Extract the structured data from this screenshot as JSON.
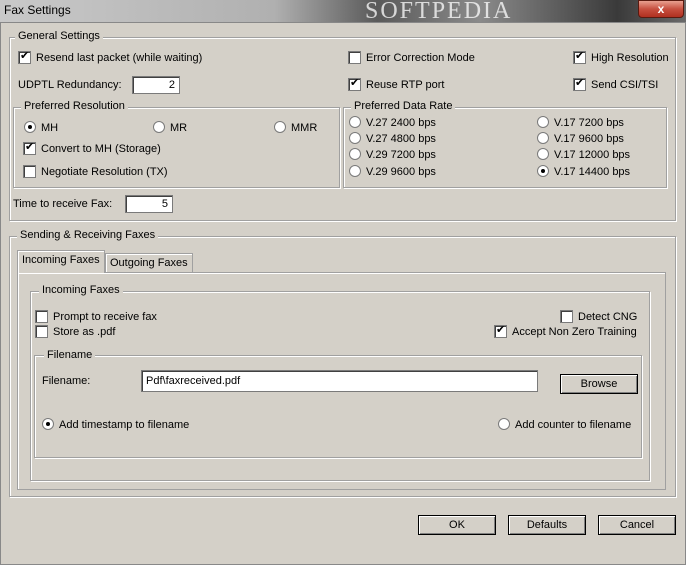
{
  "window": {
    "title": "Fax Settings",
    "watermark": "SOFTPEDIA",
    "close_glyph": "x"
  },
  "general": {
    "legend": "General Settings",
    "resend_last_packet": {
      "label": "Resend last packet (while waiting)",
      "checked": true
    },
    "error_correction": {
      "label": "Error Correction Mode",
      "checked": false
    },
    "high_resolution": {
      "label": "High Resolution",
      "checked": true
    },
    "udptl_redundancy": {
      "label": "UDPTL Redundancy:",
      "value": "2"
    },
    "reuse_rtp_port": {
      "label": "Reuse RTP port",
      "checked": true
    },
    "send_csi_tsi": {
      "label": "Send CSI/TSI",
      "checked": true
    },
    "time_to_receive": {
      "label": "Time to receive Fax:",
      "value": "5"
    }
  },
  "preferred_resolution": {
    "legend": "Preferred Resolution",
    "options": [
      "MH",
      "MR",
      "MMR"
    ],
    "selected": "MH",
    "convert_to_mh": {
      "label": "Convert to MH (Storage)",
      "checked": true
    },
    "negotiate_resolution": {
      "label": "Negotiate Resolution (TX)",
      "checked": false
    }
  },
  "preferred_data_rate": {
    "legend": "Preferred Data Rate",
    "options_left": [
      "V.27 2400 bps",
      "V.27 4800 bps",
      "V.29 7200 bps",
      "V.29 9600 bps"
    ],
    "options_right": [
      "V.17 7200 bps",
      "V.17 9600 bps",
      "V.17 12000 bps",
      "V.17 14400 bps"
    ],
    "selected": "V.17 14400 bps"
  },
  "sending_receiving": {
    "legend": "Sending & Receiving Faxes",
    "tabs": [
      "Incoming Faxes",
      "Outgoing Faxes"
    ],
    "active_tab": "Incoming Faxes",
    "incoming": {
      "legend": "Incoming Faxes",
      "prompt_to_receive": {
        "label": "Prompt to receive fax",
        "checked": false
      },
      "store_as_pdf": {
        "label": "Store as .pdf",
        "checked": false
      },
      "detect_cng": {
        "label": "Detect CNG",
        "checked": false
      },
      "accept_non_zero": {
        "label": "Accept Non Zero Training",
        "checked": true
      },
      "filename_group": {
        "legend": "Filename",
        "filename_label": "Filename:",
        "filename_value": "Pdf\\faxreceived.pdf",
        "browse_label": "Browse",
        "add_timestamp": {
          "label": "Add timestamp to filename",
          "checked": true
        },
        "add_counter": {
          "label": "Add counter to filename",
          "checked": false
        }
      }
    }
  },
  "buttons": {
    "ok": "OK",
    "defaults": "Defaults",
    "cancel": "Cancel"
  }
}
